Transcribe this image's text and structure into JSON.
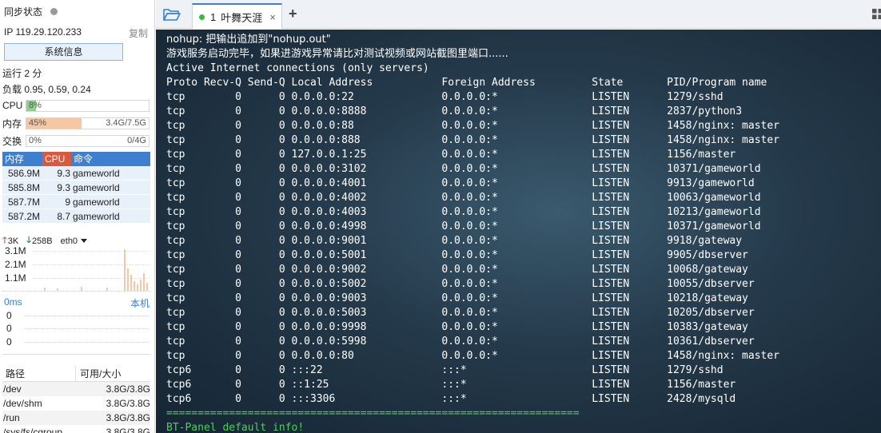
{
  "sidebar": {
    "sync_label": "同步状态",
    "ip_label": "IP 119.29.120.233",
    "copy_label": "复制",
    "sysinfo_button": "系统信息",
    "uptime": "运行 2 分",
    "load": "负载 0.95, 0.59, 0.24",
    "cpu": {
      "label": "CPU",
      "pct": "8%",
      "extra": "",
      "fraction": 0.08,
      "color": "#8fd18c"
    },
    "mem": {
      "label": "内存",
      "pct": "45%",
      "extra": "3.4G/7.5G",
      "fraction": 0.45,
      "color": "#f5c7a3"
    },
    "swap": {
      "label": "交换",
      "pct": "0%",
      "extra": "0/4G",
      "fraction": 0,
      "color": "#dddddd"
    },
    "proc_headers": {
      "mem": "内存",
      "cpu": "CPU",
      "cmd": "命令"
    },
    "processes": [
      {
        "mem": "586.9M",
        "cpu": "9.3",
        "cmd": "gameworld"
      },
      {
        "mem": "585.8M",
        "cpu": "9.3",
        "cmd": "gameworld"
      },
      {
        "mem": "587.7M",
        "cpu": "9",
        "cmd": "gameworld"
      },
      {
        "mem": "587.2M",
        "cpu": "8.7",
        "cmd": "gameworld"
      }
    ],
    "net": {
      "up": "3K",
      "down": "258B",
      "iface": "eth0",
      "ticks": [
        "3.1M",
        "2.1M",
        "1.1M"
      ]
    },
    "ping": {
      "latency": "0ms",
      "target": "本机",
      "ticks": [
        "0",
        "0",
        "0"
      ]
    },
    "disk_headers": {
      "path": "路径",
      "size": "可用/大小"
    },
    "disks": [
      {
        "path": "/dev",
        "size": "3.8G/3.8G"
      },
      {
        "path": "/dev/shm",
        "size": "3.8G/3.8G"
      },
      {
        "path": "/run",
        "size": "3.8G/3.8G"
      },
      {
        "path": "/sys/fs/cgroup",
        "size": "3.8G/3.8G"
      }
    ]
  },
  "tab": {
    "number": "1",
    "title": "叶舞天涯",
    "close": "×"
  },
  "add_tab": "+",
  "terminal": {
    "lines": [
      {
        "text": "nohup: 把输出追加到\"nohup.out\"",
        "cls": ""
      },
      {
        "text": "游戏服务启动完毕，如果进游戏异常请比对测试视频或网站截图里端口......",
        "cls": ""
      },
      {
        "text": "Active Internet connections (only servers)",
        "cls": ""
      },
      {
        "text": "Proto Recv-Q Send-Q Local Address           Foreign Address         State       PID/Program name",
        "cls": ""
      },
      {
        "text": "tcp        0      0 0.0.0.0:22              0.0.0.0:*               LISTEN      1279/sshd",
        "cls": ""
      },
      {
        "text": "tcp        0      0 0.0.0.0:8888            0.0.0.0:*               LISTEN      2837/python3",
        "cls": ""
      },
      {
        "text": "tcp        0      0 0.0.0.0:88              0.0.0.0:*               LISTEN      1458/nginx: master",
        "cls": ""
      },
      {
        "text": "tcp        0      0 0.0.0.0:888             0.0.0.0:*               LISTEN      1458/nginx: master",
        "cls": ""
      },
      {
        "text": "tcp        0      0 127.0.0.1:25            0.0.0.0:*               LISTEN      1156/master",
        "cls": ""
      },
      {
        "text": "tcp        0      0 0.0.0.0:3102            0.0.0.0:*               LISTEN      10371/gameworld",
        "cls": ""
      },
      {
        "text": "tcp        0      0 0.0.0.0:4001            0.0.0.0:*               LISTEN      9913/gameworld",
        "cls": ""
      },
      {
        "text": "tcp        0      0 0.0.0.0:4002            0.0.0.0:*               LISTEN      10063/gameworld",
        "cls": ""
      },
      {
        "text": "tcp        0      0 0.0.0.0:4003            0.0.0.0:*               LISTEN      10213/gameworld",
        "cls": ""
      },
      {
        "text": "tcp        0      0 0.0.0.0:4998            0.0.0.0:*               LISTEN      10371/gameworld",
        "cls": ""
      },
      {
        "text": "tcp        0      0 0.0.0.0:9001            0.0.0.0:*               LISTEN      9918/gateway",
        "cls": ""
      },
      {
        "text": "tcp        0      0 0.0.0.0:5001            0.0.0.0:*               LISTEN      9905/dbserver",
        "cls": ""
      },
      {
        "text": "tcp        0      0 0.0.0.0:9002            0.0.0.0:*               LISTEN      10068/gateway",
        "cls": ""
      },
      {
        "text": "tcp        0      0 0.0.0.0:5002            0.0.0.0:*               LISTEN      10055/dbserver",
        "cls": ""
      },
      {
        "text": "tcp        0      0 0.0.0.0:9003            0.0.0.0:*               LISTEN      10218/gateway",
        "cls": ""
      },
      {
        "text": "tcp        0      0 0.0.0.0:5003            0.0.0.0:*               LISTEN      10205/dbserver",
        "cls": ""
      },
      {
        "text": "tcp        0      0 0.0.0.0:9998            0.0.0.0:*               LISTEN      10383/gateway",
        "cls": ""
      },
      {
        "text": "tcp        0      0 0.0.0.0:5998            0.0.0.0:*               LISTEN      10361/dbserver",
        "cls": ""
      },
      {
        "text": "tcp        0      0 0.0.0.0:80              0.0.0.0:*               LISTEN      1458/nginx: master",
        "cls": ""
      },
      {
        "text": "tcp6       0      0 :::22                   :::*                    LISTEN      1279/sshd",
        "cls": ""
      },
      {
        "text": "tcp6       0      0 ::1:25                  :::*                    LISTEN      1156/master",
        "cls": ""
      },
      {
        "text": "tcp6       0      0 :::3306                 :::*                    LISTEN      2428/mysqld",
        "cls": ""
      },
      {
        "text": "==================================================================",
        "cls": "green"
      },
      {
        "text": "BT-Panel default info!",
        "cls": "green"
      }
    ]
  }
}
